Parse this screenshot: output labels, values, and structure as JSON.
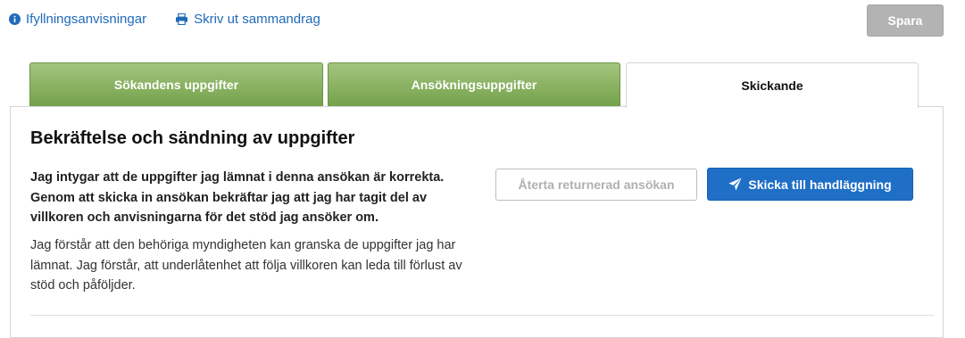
{
  "toolbar": {
    "instructions_label": "Ifyllningsanvisningar",
    "print_label": "Skriv ut sammandrag",
    "save_label": "Spara"
  },
  "tabs": [
    {
      "label": "Sökandens uppgifter",
      "state": "completed"
    },
    {
      "label": "Ansökningsuppgifter",
      "state": "completed"
    },
    {
      "label": "Skickande",
      "state": "active"
    }
  ],
  "main": {
    "title": "Bekräftelse och sändning av uppgifter",
    "confirmation_text": "Jag intygar att de uppgifter jag lämnat i denna ansökan är korrekta. Genom att skicka in ansökan bekräftar jag att jag har tagit del av villkoren och anvisningarna för det stöd jag ansöker om.",
    "notice_text": "Jag förstår att den behöriga myndigheten kan granska de uppgifter jag har lämnat. Jag förstår, att underlåtenhet att följa villkoren kan leda till förlust av stöd och påföljder.",
    "withdraw_label": "Återta returnerad ansökan",
    "send_label": "Skicka till handläggning"
  },
  "icons": {
    "instructions": "info-circle-icon",
    "print": "printer-icon",
    "send": "paper-plane-icon"
  },
  "colors": {
    "link": "#1f6bb8",
    "primary": "#1f6fc7",
    "tab_completed": "#74a14a",
    "disabled": "#b3b3b3"
  }
}
